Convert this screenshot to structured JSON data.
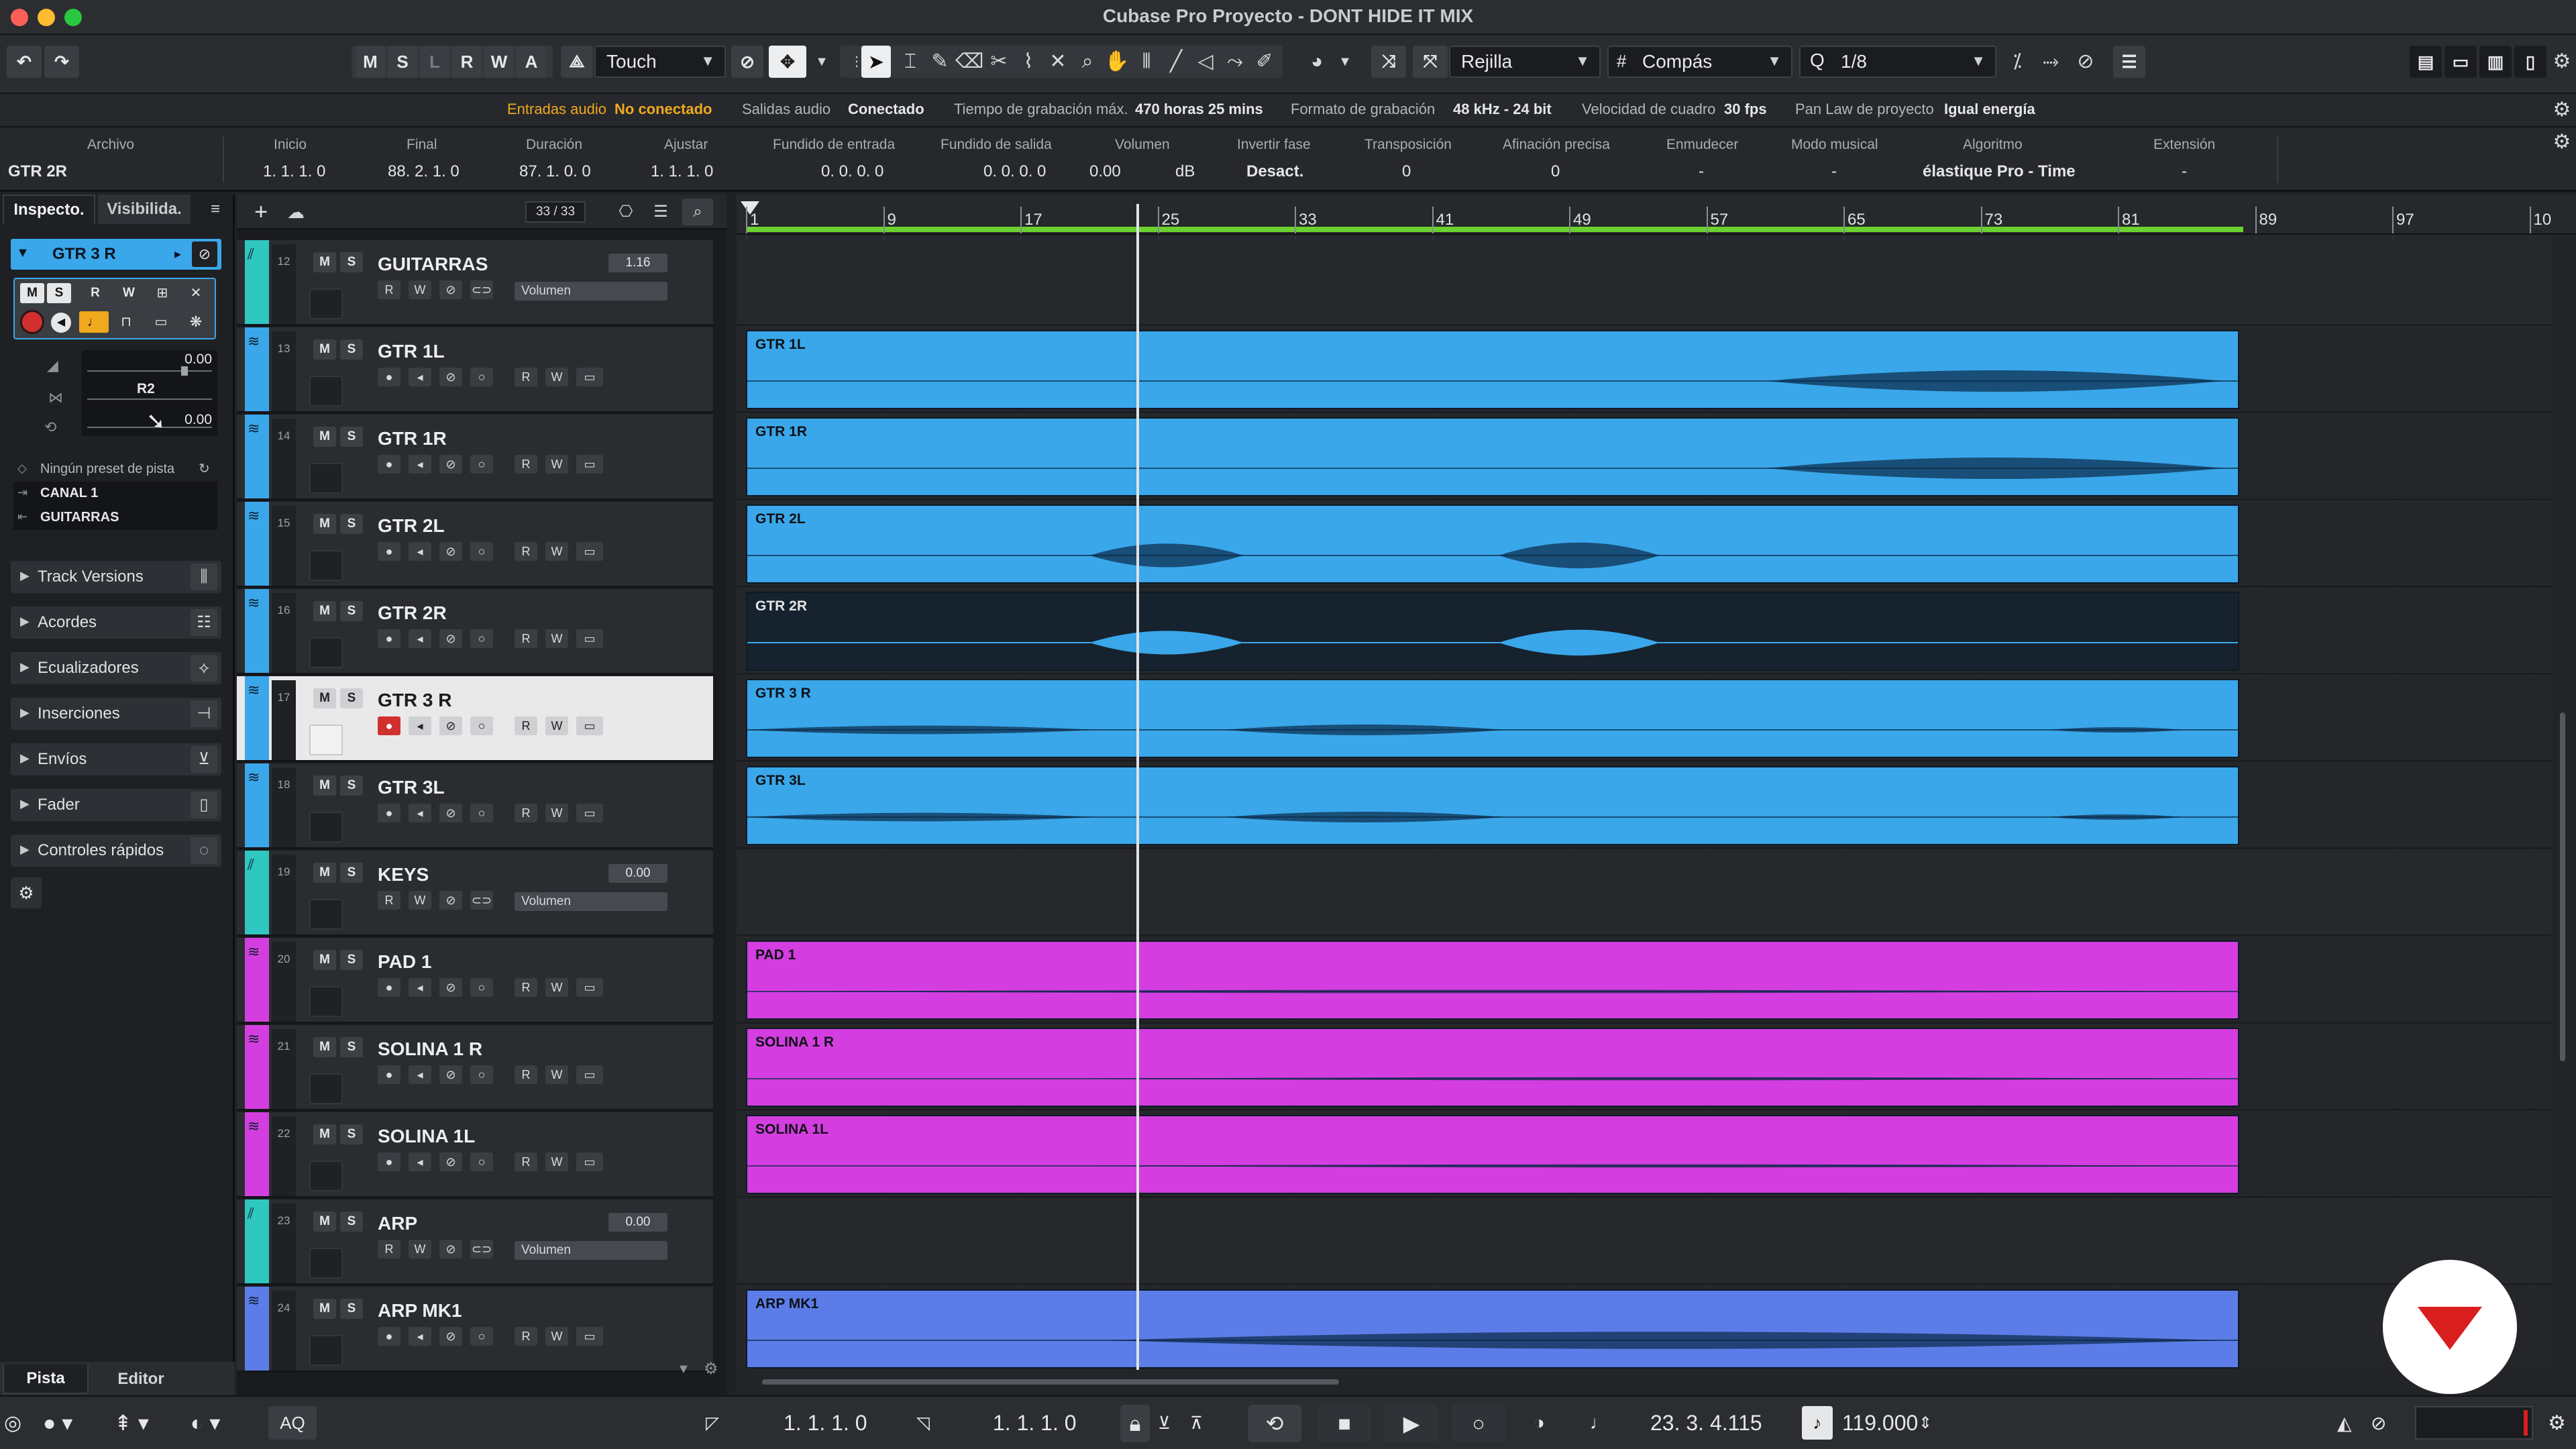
{
  "window": {
    "title": "Cubase Pro Proyecto - DONT HIDE IT MIX"
  },
  "toolbar": {
    "undo_icon": "undo-icon",
    "redo_icon": "redo-icon",
    "state_buttons": [
      "M",
      "S",
      "L",
      "R",
      "W",
      "A"
    ],
    "automation_mode": "Touch",
    "snap_type": "Rejilla",
    "grid_type": "Compás",
    "quantize": "1/8"
  },
  "status": {
    "audio_inputs_label": "Entradas audio",
    "audio_inputs_value": "No conectado",
    "audio_outputs_label": "Salidas audio",
    "audio_outputs_value": "Conectado",
    "rec_time_label": "Tiempo de grabación máx.",
    "rec_time_value": "470 horas 25 mins",
    "rec_format_label": "Formato de grabación",
    "rec_format_value": "48 kHz - 24 bit",
    "frame_rate_label": "Velocidad de cuadro",
    "frame_rate_value": "30 fps",
    "pan_law_label": "Pan Law de proyecto",
    "pan_law_value": "Igual energía"
  },
  "infoline": {
    "file_label": "Archivo",
    "file_value": "GTR 2R",
    "start_label": "Inicio",
    "start_value": "1. 1. 1.   0",
    "end_label": "Final",
    "end_value": "88. 2. 1.   0",
    "length_label": "Duración",
    "length_value": "87. 1. 0.   0",
    "snap_label": "Ajustar",
    "snap_value": "1. 1. 1.   0",
    "fadein_label": "Fundido de entrada",
    "fadein_value": "0. 0. 0.   0",
    "fadeout_label": "Fundido de salida",
    "fadeout_value": "0. 0. 0.   0",
    "volume_label": "Volumen",
    "volume_value": "0.00",
    "volume_unit": "dB",
    "invert_label": "Invertir fase",
    "invert_value": "Desact.",
    "transpose_label": "Transposición",
    "transpose_value": "0",
    "finetune_label": "Afinación precisa",
    "finetune_value": "0",
    "mute_label": "Enmudecer",
    "mute_value": "-",
    "musical_label": "Modo musical",
    "musical_value": "-",
    "algo_label": "Algoritmo",
    "algo_value": "élastique Pro - Time",
    "ext_label": "Extensión",
    "ext_value": "-"
  },
  "inspector": {
    "tab_inspector": "Inspecto.",
    "tab_visibility": "Visibilida.",
    "track_name": "GTR 3 R",
    "volume_value": "0.00",
    "pan_value": "R2",
    "delay_value": "0.00",
    "preset_text": "Ningún preset de pista",
    "routing_in": "CANAL 1",
    "routing_out": "GUITARRAS",
    "sections": [
      "Track Versions",
      "Acordes",
      "Ecualizadores",
      "Inserciones",
      "Envíos",
      "Fader",
      "Controles rápidos"
    ],
    "bottom_tab_track": "Pista",
    "bottom_tab_editor": "Editor"
  },
  "tracklist": {
    "count": "33 / 33",
    "tracks": [
      {
        "num": "12",
        "name": "GUITARRAS",
        "kind": "group",
        "vol": "1.16",
        "vol_label": "Volumen"
      },
      {
        "num": "13",
        "name": "GTR 1L",
        "kind": "audio"
      },
      {
        "num": "14",
        "name": "GTR 1R",
        "kind": "audio"
      },
      {
        "num": "15",
        "name": "GTR 2L",
        "kind": "audio"
      },
      {
        "num": "16",
        "name": "GTR 2R",
        "kind": "audio"
      },
      {
        "num": "17",
        "name": "GTR 3 R",
        "kind": "audio"
      },
      {
        "num": "18",
        "name": "GTR 3L",
        "kind": "audio"
      },
      {
        "num": "19",
        "name": "KEYS",
        "kind": "group",
        "vol": "0.00",
        "vol_label": "Volumen"
      },
      {
        "num": "20",
        "name": "PAD 1",
        "kind": "audio"
      },
      {
        "num": "21",
        "name": "SOLINA 1 R",
        "kind": "audio"
      },
      {
        "num": "22",
        "name": "SOLINA 1L",
        "kind": "audio"
      },
      {
        "num": "23",
        "name": "ARP",
        "kind": "group",
        "vol": "0.00",
        "vol_label": "Volumen"
      },
      {
        "num": "24",
        "name": "ARP MK1",
        "kind": "audio"
      }
    ]
  },
  "ruler": {
    "bars": [
      "1",
      "9",
      "17",
      "25",
      "33",
      "41",
      "49",
      "57",
      "65",
      "73",
      "81",
      "89",
      "97",
      "10"
    ]
  },
  "events": [
    "GTR 1L",
    "GTR 1R",
    "GTR 2L",
    "GTR 2R",
    "GTR 3 R",
    "GTR 3L",
    "PAD 1",
    "SOLINA 1 R",
    "SOLINA 1L",
    "ARP MK1"
  ],
  "transport": {
    "left_locator": "1. 1. 1.   0",
    "right_locator": "1. 1. 1.   0",
    "position": "23. 3. 4.115",
    "tempo": "119.000",
    "aq_label": "AQ"
  },
  "colors": {
    "audio_blue": "#3aa7ea",
    "audio_blue_dark": "#16222e",
    "pink": "#d43ee0",
    "arp_blue": "#5c7de8",
    "group_teal": "#2fc7c0",
    "cycle_green": "#6bd12f",
    "rec_red": "#d0302e",
    "accent_orange": "#f0a81c",
    "brand_red": "#d91e1e"
  }
}
